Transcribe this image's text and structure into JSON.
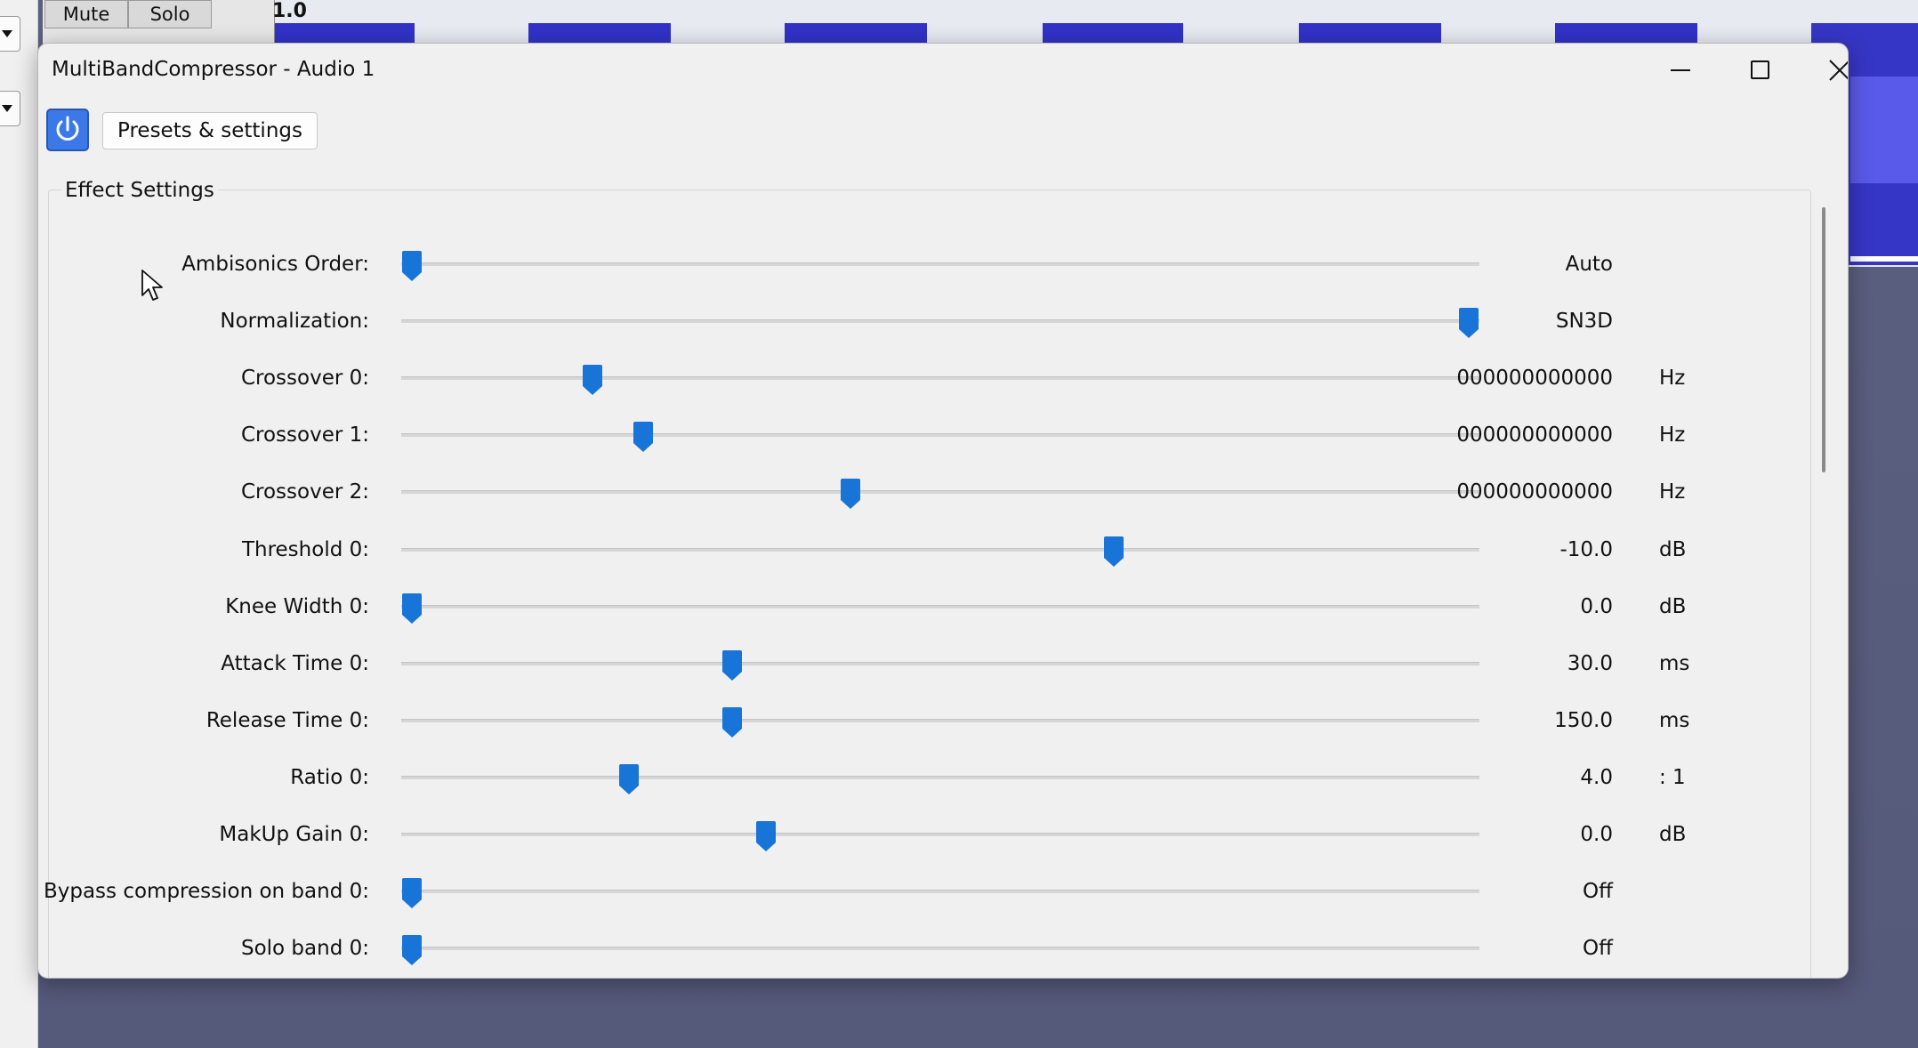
{
  "background_app": {
    "mute_label": "Mute",
    "solo_label": "Solo",
    "gain_value": "1.0"
  },
  "dialog": {
    "title": "MultiBandCompressor - Audio 1",
    "window_buttons": [
      "minimize-icon",
      "maximize-icon",
      "close-icon"
    ],
    "power_button_icon": "power-icon",
    "presets_button_label": "Presets & settings",
    "group_label": "Effect Settings",
    "accent_color": "#1874d6",
    "settings": [
      {
        "label": "Ambisonics Order:",
        "position": 0.0,
        "value": "Auto",
        "unit": ""
      },
      {
        "label": "Normalization:",
        "position": 1.0,
        "value": "SN3D",
        "unit": ""
      },
      {
        "label": "Crossover 0:",
        "position": 0.171,
        "value": "000000000000",
        "unit": "Hz"
      },
      {
        "label": "Crossover 1:",
        "position": 0.219,
        "value": "000000000000",
        "unit": "Hz"
      },
      {
        "label": "Crossover 2:",
        "position": 0.415,
        "value": "000000000000",
        "unit": "Hz"
      },
      {
        "label": "Threshold 0:",
        "position": 0.664,
        "value": "-10.0",
        "unit": "dB"
      },
      {
        "label": "Knee Width 0:",
        "position": 0.0,
        "value": "0.0",
        "unit": "dB"
      },
      {
        "label": "Attack Time 0:",
        "position": 0.303,
        "value": "30.0",
        "unit": "ms"
      },
      {
        "label": "Release Time 0:",
        "position": 0.303,
        "value": "150.0",
        "unit": "ms"
      },
      {
        "label": "Ratio 0:",
        "position": 0.205,
        "value": "4.0",
        "unit": ": 1"
      },
      {
        "label": "MakUp Gain 0:",
        "position": 0.335,
        "value": "0.0",
        "unit": "dB"
      },
      {
        "label": "Bypass compression on band 0:",
        "position": 0.0,
        "value": "Off",
        "unit": ""
      },
      {
        "label": "Solo band 0:",
        "position": 0.0,
        "value": "Off",
        "unit": ""
      }
    ]
  }
}
